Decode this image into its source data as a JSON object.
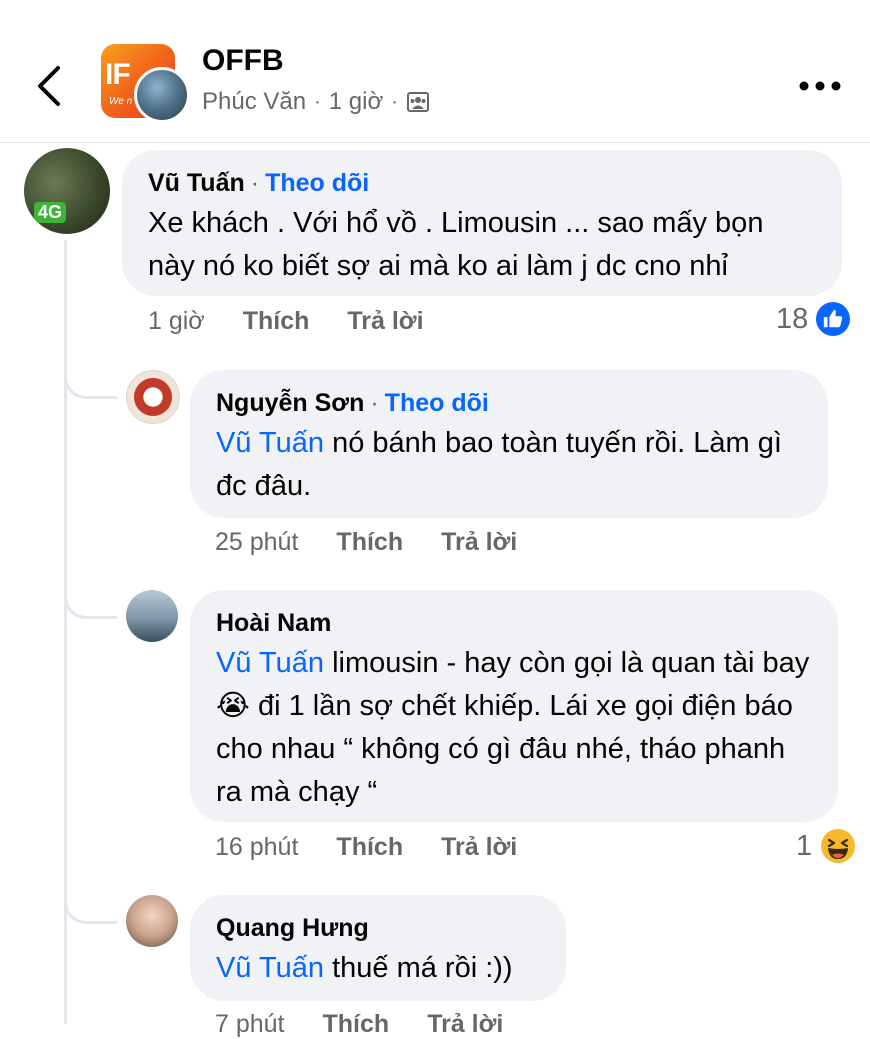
{
  "header": {
    "group_name": "OFFB",
    "author": "Phúc Văn",
    "time": "1 giờ",
    "separator": "·",
    "group_avatar_text": "IF",
    "group_avatar_sub": "We n"
  },
  "comments": [
    {
      "author": "Vũ Tuấn",
      "follow_label": "Theo dõi",
      "separator": "·",
      "mention": "",
      "text": "Xe khách . Với hổ vồ . Limousin ... sao mấy bọn này nó ko biết sợ ai mà ko ai làm j dc cno nhỉ",
      "time": "1 giờ",
      "like_label": "Thích",
      "reply_label": "Trả lời",
      "reaction_count": "18",
      "reaction_icon": "like-icon",
      "avatar_badge": "4G"
    },
    {
      "author": "Nguyễn Sơn",
      "follow_label": "Theo dõi",
      "separator": "·",
      "mention": "Vũ Tuấn",
      "text": " nó bánh bao toàn tuyến rồi. Làm gì đc đâu.",
      "time": "25 phút",
      "like_label": "Thích",
      "reply_label": "Trả lời"
    },
    {
      "author": "Hoài Nam",
      "mention": "Vũ Tuấn",
      "text": " limousin - hay còn gọi là quan tài bay 😭  đi 1 lần sợ chết khiếp. Lái xe gọi điện báo cho nhau “ không có gì đâu nhé, tháo phanh ra mà chạy “",
      "time": "16 phút",
      "like_label": "Thích",
      "reply_label": "Trả lời",
      "reaction_count": "1",
      "reaction_icon": "haha-icon"
    },
    {
      "author": "Quang Hưng",
      "mention": "Vũ Tuấn",
      "text": " thuế má rồi :))",
      "time": "7 phút",
      "like_label": "Thích",
      "reply_label": "Trả lời"
    }
  ]
}
